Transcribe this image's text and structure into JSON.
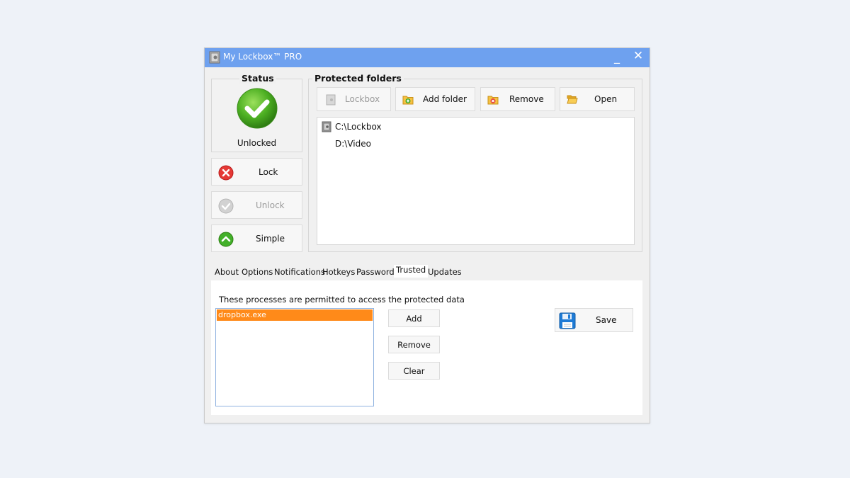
{
  "window": {
    "title": "My Lockbox™ PRO",
    "minimize_glyph": "_",
    "close_glyph": "✕",
    "accent_color": "#6ea1ef"
  },
  "status": {
    "heading": "Status",
    "state_label": "Unlocked",
    "state_icon": "check-circle-icon",
    "state_color": "#4caf22"
  },
  "actions": {
    "lock_label": "Lock",
    "unlock_label": "Unlock",
    "simple_label": "Simple"
  },
  "folders": {
    "heading": "Protected folders",
    "toolbar": {
      "lockbox_label": "Lockbox",
      "add_folder_label": "Add folder",
      "remove_label": "Remove",
      "open_label": "Open"
    },
    "items": [
      {
        "path": "C:\\Lockbox",
        "icon": "safe-icon"
      },
      {
        "path": "D:\\Video",
        "icon": ""
      }
    ]
  },
  "tabs": [
    {
      "label": "About"
    },
    {
      "label": "Options"
    },
    {
      "label": "Notifications"
    },
    {
      "label": "Hotkeys"
    },
    {
      "label": "Password"
    },
    {
      "label": "Trusted",
      "active": true
    },
    {
      "label": "Updates"
    }
  ],
  "trusted": {
    "description": "These processes are permitted to access the protected data",
    "processes": [
      "dropbox.exe"
    ],
    "selected_color": "#ff8a19",
    "add_label": "Add",
    "remove_label": "Remove",
    "clear_label": "Clear",
    "save_label": "Save"
  }
}
